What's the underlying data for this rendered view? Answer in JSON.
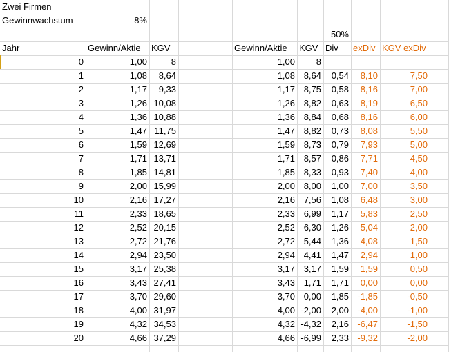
{
  "sheet": {
    "title": "Zwei Firmen",
    "growth_label": "Gewinnwachstum",
    "growth_value": "8%",
    "payout_value": "50%",
    "headers": {
      "jahr": "Jahr",
      "gewinn1": "Gewinn/Aktie",
      "kgv1": "KGV",
      "gewinn2": "Gewinn/Aktie",
      "kgv2": "KGV",
      "div": "Div",
      "exdiv": "exDiv",
      "kgvexdiv": "KGV exDiv"
    },
    "accent_color": "#e26b0a",
    "rows": [
      [
        "0",
        "1,00",
        "8",
        "1,00",
        "8",
        "",
        "",
        ""
      ],
      [
        "1",
        "1,08",
        "8,64",
        "1,08",
        "8,64",
        "0,54",
        "8,10",
        "7,50"
      ],
      [
        "2",
        "1,17",
        "9,33",
        "1,17",
        "8,75",
        "0,58",
        "8,16",
        "7,00"
      ],
      [
        "3",
        "1,26",
        "10,08",
        "1,26",
        "8,82",
        "0,63",
        "8,19",
        "6,50"
      ],
      [
        "4",
        "1,36",
        "10,88",
        "1,36",
        "8,84",
        "0,68",
        "8,16",
        "6,00"
      ],
      [
        "5",
        "1,47",
        "11,75",
        "1,47",
        "8,82",
        "0,73",
        "8,08",
        "5,50"
      ],
      [
        "6",
        "1,59",
        "12,69",
        "1,59",
        "8,73",
        "0,79",
        "7,93",
        "5,00"
      ],
      [
        "7",
        "1,71",
        "13,71",
        "1,71",
        "8,57",
        "0,86",
        "7,71",
        "4,50"
      ],
      [
        "8",
        "1,85",
        "14,81",
        "1,85",
        "8,33",
        "0,93",
        "7,40",
        "4,00"
      ],
      [
        "9",
        "2,00",
        "15,99",
        "2,00",
        "8,00",
        "1,00",
        "7,00",
        "3,50"
      ],
      [
        "10",
        "2,16",
        "17,27",
        "2,16",
        "7,56",
        "1,08",
        "6,48",
        "3,00"
      ],
      [
        "11",
        "2,33",
        "18,65",
        "2,33",
        "6,99",
        "1,17",
        "5,83",
        "2,50"
      ],
      [
        "12",
        "2,52",
        "20,15",
        "2,52",
        "6,30",
        "1,26",
        "5,04",
        "2,00"
      ],
      [
        "13",
        "2,72",
        "21,76",
        "2,72",
        "5,44",
        "1,36",
        "4,08",
        "1,50"
      ],
      [
        "14",
        "2,94",
        "23,50",
        "2,94",
        "4,41",
        "1,47",
        "2,94",
        "1,00"
      ],
      [
        "15",
        "3,17",
        "25,38",
        "3,17",
        "3,17",
        "1,59",
        "1,59",
        "0,50"
      ],
      [
        "16",
        "3,43",
        "27,41",
        "3,43",
        "1,71",
        "1,71",
        "0,00",
        "0,00"
      ],
      [
        "17",
        "3,70",
        "29,60",
        "3,70",
        "0,00",
        "1,85",
        "-1,85",
        "-0,50"
      ],
      [
        "18",
        "4,00",
        "31,97",
        "4,00",
        "-2,00",
        "2,00",
        "-4,00",
        "-1,00"
      ],
      [
        "19",
        "4,32",
        "34,53",
        "4,32",
        "-4,32",
        "2,16",
        "-6,47",
        "-1,50"
      ],
      [
        "20",
        "4,66",
        "37,29",
        "4,66",
        "-6,99",
        "2,33",
        "-9,32",
        "-2,00"
      ]
    ]
  }
}
